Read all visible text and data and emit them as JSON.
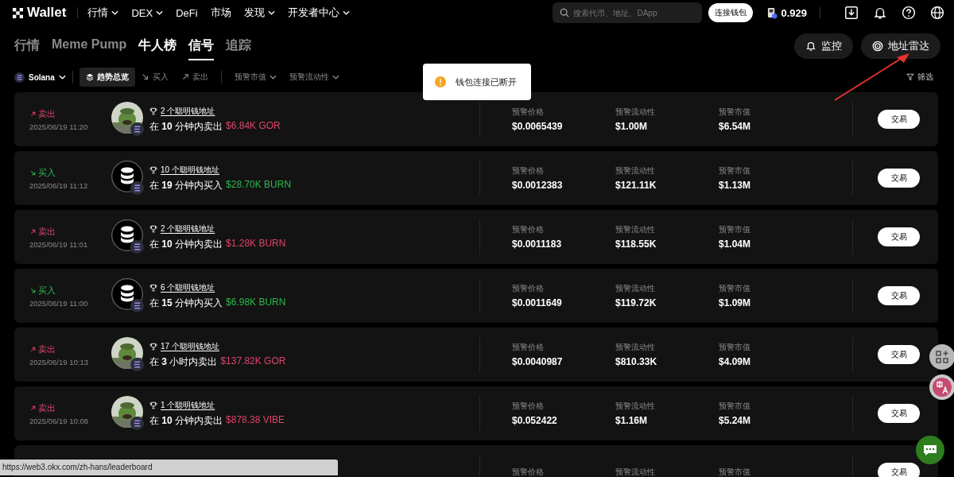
{
  "nav": {
    "logo": "Wallet",
    "items": [
      {
        "label": "行情",
        "dropdown": true
      },
      {
        "label": "DEX",
        "dropdown": true
      },
      {
        "label": "DeFi",
        "dropdown": false
      },
      {
        "label": "市场",
        "dropdown": false
      },
      {
        "label": "发现",
        "dropdown": true
      },
      {
        "label": "开发者中心",
        "dropdown": true
      }
    ],
    "search": {
      "placeholder": "搜索代币、地址、DApp"
    },
    "connect_button": "连接钱包",
    "gas": "0.929"
  },
  "tabs": [
    {
      "label": "行情",
      "selected": false,
      "highlighted": false
    },
    {
      "label": "Meme Pump",
      "selected": false,
      "highlighted": false
    },
    {
      "label": "牛人榜",
      "selected": false,
      "highlighted": true
    },
    {
      "label": "信号",
      "selected": true,
      "highlighted": false
    },
    {
      "label": "追踪",
      "selected": false,
      "highlighted": false
    }
  ],
  "actions": [
    "监控",
    "地址雷达"
  ],
  "filters": {
    "chain": "Solana",
    "items": [
      {
        "label": "趋势总览",
        "kind": "overview",
        "selected": true
      },
      {
        "label": "买入",
        "kind": "buy",
        "selected": false
      },
      {
        "label": "卖出",
        "kind": "sell",
        "selected": false
      },
      {
        "label": "预警市值",
        "kind": "dropdown",
        "selected": false
      },
      {
        "label": "预警流动性",
        "kind": "dropdown",
        "selected": false
      }
    ],
    "filter_button": "筛选"
  },
  "toast": {
    "message": "钱包连接已断开"
  },
  "signals": [
    {
      "kind": "sell",
      "side_label": "卖出",
      "time": "2025/06/19 11:20",
      "wallets": "2 个聪明钱地址",
      "summary": "在 **10** 分钟内卖出",
      "amount": "$6.84K GOR",
      "metrics": [
        {
          "label": "预警价格",
          "value": "$0.0065439"
        },
        {
          "label": "预警流动性",
          "value": "$1.00M"
        },
        {
          "label": "预警市值",
          "value": "$6.54M"
        }
      ],
      "button": "交易"
    },
    {
      "kind": "buy",
      "side_label": "买入",
      "time": "2025/06/19 11:12",
      "avatar": {
        "kind": "coins"
      },
      "wallets": "10 个聪明钱地址",
      "summary": "在 **19** 分钟内买入",
      "amount": "$28.70K BURN",
      "metrics": [
        {
          "label": "预警价格",
          "value": "$0.0012383"
        },
        {
          "label": "预警流动性",
          "value": "$121.11K"
        },
        {
          "label": "预警市值",
          "value": "$1.13M"
        }
      ],
      "button": "交易"
    },
    {
      "kind": "sell",
      "side_label": "卖出",
      "time": "2025/06/19 11:01",
      "avatar": {
        "kind": "coins"
      },
      "wallets": "2 个聪明钱地址",
      "summary": "在 **10** 分钟内卖出",
      "amount": "$1.28K BURN",
      "metrics": [
        {
          "label": "预警价格",
          "value": "$0.0011183"
        },
        {
          "label": "预警流动性",
          "value": "$118.55K"
        },
        {
          "label": "预警市值",
          "value": "$1.04M"
        }
      ],
      "button": "交易"
    },
    {
      "kind": "buy",
      "side_label": "买入",
      "time": "2025/06/19 11:00",
      "avatar": {
        "kind": "coins"
      },
      "wallets": "6 个聪明钱地址",
      "summary": "在 **15** 分钟内买入",
      "amount": "$6.98K BURN",
      "metrics": [
        {
          "label": "预警价格",
          "value": "$0.0011649"
        },
        {
          "label": "预警流动性",
          "value": "$119.72K"
        },
        {
          "label": "预警市值",
          "value": "$1.09M"
        }
      ],
      "button": "交易"
    },
    {
      "kind": "sell",
      "side_label": "卖出",
      "time": "2025/06/19 10:13",
      "wallets": "17 个聪明钱地址",
      "summary": "在 **3** 小时内卖出",
      "amount": "$137.82K GOR",
      "metrics": [
        {
          "label": "预警价格",
          "value": "$0.0040987"
        },
        {
          "label": "预警流动性",
          "value": "$810.33K"
        },
        {
          "label": "预警市值",
          "value": "$4.09M"
        }
      ],
      "button": "交易"
    },
    {
      "kind": "sell",
      "side_label": "卖出",
      "time": "2025/06/19 10:08",
      "wallets": "1 个聪明钱地址",
      "summary": "在 **10** 分钟内卖出",
      "amount": "$878.38 VIBE",
      "metrics": [
        {
          "label": "预警价格",
          "value": "$0.052422"
        },
        {
          "label": "预警流动性",
          "value": "$1.16M"
        },
        {
          "label": "预警市值",
          "value": "$5.24M"
        }
      ],
      "button": "交易"
    },
    {
      "metrics": [
        {
          "label": "预警价格"
        },
        {
          "label": "预警流动性"
        },
        {
          "label": "预警市值"
        }
      ],
      "button": "交易"
    }
  ],
  "status_url": "https://web3.okx.com/zh-hans/leaderboard"
}
